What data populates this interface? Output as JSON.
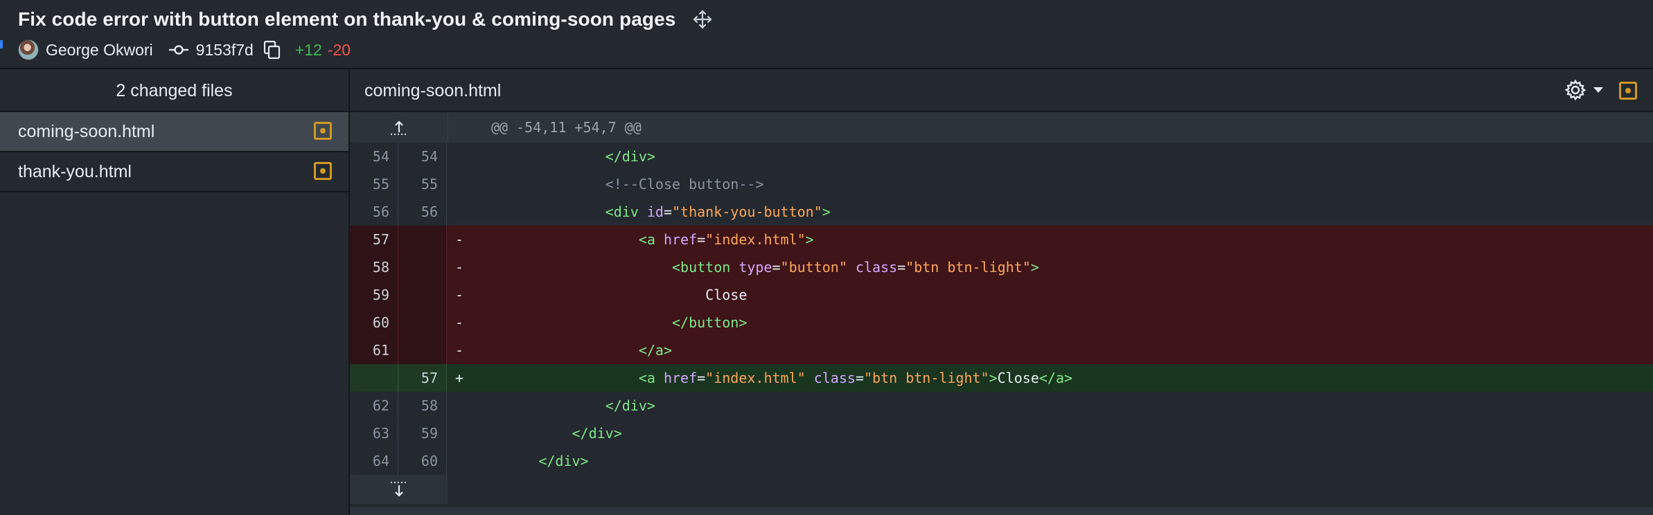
{
  "header": {
    "title": "Fix code error with button element on thank-you & coming-soon pages",
    "author": "George Okwori",
    "sha": "9153f7d",
    "additions": "+12",
    "deletions": "-20"
  },
  "sidebar": {
    "heading": "2 changed files",
    "files": [
      {
        "name": "coming-soon.html",
        "selected": true
      },
      {
        "name": "thank-you.html",
        "selected": false
      }
    ]
  },
  "diff": {
    "file_name": "coming-soon.html",
    "hunk_header": "@@ -54,11 +54,7 @@",
    "lines": [
      {
        "type": "ctx",
        "old": "54",
        "new": "54",
        "sign": "",
        "indent": 8,
        "tokens": [
          [
            "tag",
            "</div>"
          ]
        ]
      },
      {
        "type": "ctx",
        "old": "55",
        "new": "55",
        "sign": "",
        "indent": 8,
        "tokens": [
          [
            "com",
            "<!--Close button-->"
          ]
        ]
      },
      {
        "type": "ctx",
        "old": "56",
        "new": "56",
        "sign": "",
        "indent": 8,
        "tokens": [
          [
            "tag",
            "<div "
          ],
          [
            "attr",
            "id"
          ],
          [
            "punc",
            "="
          ],
          [
            "str",
            "\"thank-you-button\""
          ],
          [
            "tag",
            ">"
          ]
        ]
      },
      {
        "type": "del",
        "old": "57",
        "new": "",
        "sign": "-",
        "indent": 10,
        "tokens": [
          [
            "tag",
            "<a "
          ],
          [
            "attr",
            "href"
          ],
          [
            "punc",
            "="
          ],
          [
            "str",
            "\"index.html\""
          ],
          [
            "tag",
            ">"
          ]
        ]
      },
      {
        "type": "del",
        "old": "58",
        "new": "",
        "sign": "-",
        "indent": 12,
        "tokens": [
          [
            "tag",
            "<button "
          ],
          [
            "attr",
            "type"
          ],
          [
            "punc",
            "="
          ],
          [
            "str",
            "\"button\""
          ],
          [
            "txt",
            " "
          ],
          [
            "attr",
            "class"
          ],
          [
            "punc",
            "="
          ],
          [
            "str",
            "\"btn btn-light\""
          ],
          [
            "tag",
            ">"
          ]
        ]
      },
      {
        "type": "del",
        "old": "59",
        "new": "",
        "sign": "-",
        "indent": 14,
        "tokens": [
          [
            "txt",
            "Close"
          ]
        ]
      },
      {
        "type": "del",
        "old": "60",
        "new": "",
        "sign": "-",
        "indent": 12,
        "tokens": [
          [
            "tag",
            "</button>"
          ]
        ]
      },
      {
        "type": "del",
        "old": "61",
        "new": "",
        "sign": "-",
        "indent": 10,
        "tokens": [
          [
            "tag",
            "</a>"
          ]
        ]
      },
      {
        "type": "add",
        "old": "",
        "new": "57",
        "sign": "+",
        "indent": 10,
        "tokens": [
          [
            "tag",
            "<a "
          ],
          [
            "attr",
            "href"
          ],
          [
            "punc",
            "="
          ],
          [
            "str",
            "\"index.html\""
          ],
          [
            "txt",
            " "
          ],
          [
            "attr",
            "class"
          ],
          [
            "punc",
            "="
          ],
          [
            "str",
            "\"btn btn-light\""
          ],
          [
            "tag",
            ">"
          ],
          [
            "txt",
            "Close"
          ],
          [
            "tag",
            "</a>"
          ]
        ]
      },
      {
        "type": "ctx",
        "old": "62",
        "new": "58",
        "sign": "",
        "indent": 8,
        "tokens": [
          [
            "tag",
            "</div>"
          ]
        ]
      },
      {
        "type": "ctx",
        "old": "63",
        "new": "59",
        "sign": "",
        "indent": 6,
        "tokens": [
          [
            "tag",
            "</div>"
          ]
        ]
      },
      {
        "type": "ctx",
        "old": "64",
        "new": "60",
        "sign": "",
        "indent": 4,
        "tokens": [
          [
            "tag",
            "</div>"
          ]
        ]
      }
    ]
  },
  "icons": {
    "move": "move-arrows-icon",
    "commit": "git-commit-icon",
    "copy": "copy-icon",
    "gear": "gear-icon",
    "file_modified": "file-modified-icon",
    "expand_up": "expand-up-icon",
    "expand_down": "expand-down-icon"
  },
  "colors": {
    "background": "#24292f",
    "added_text": "#3fb950",
    "deleted_text": "#f85149",
    "deleted_row": "#3e1418",
    "added_row": "#19351f",
    "modified_badge": "#d29922"
  }
}
